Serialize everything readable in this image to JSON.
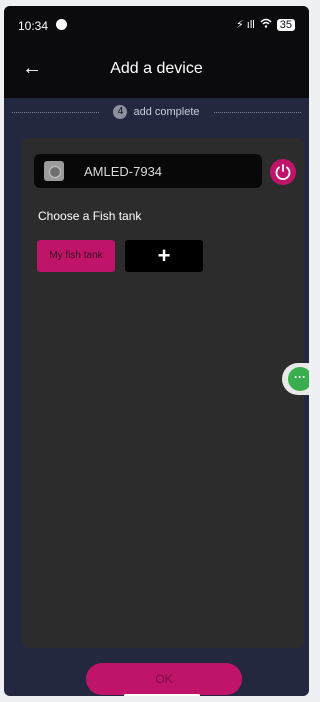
{
  "status_bar": {
    "time": "10:34",
    "indicators": "⚡ ıll",
    "wifi_icon": "wifi-icon",
    "battery": "35"
  },
  "header": {
    "back_icon": "back-arrow-icon",
    "title": "Add a device"
  },
  "step": {
    "number": "4",
    "label": "add complete"
  },
  "device": {
    "name": "AMLED-7934",
    "power_icon": "power-icon"
  },
  "fish_tank": {
    "label": "Choose a Fish tank",
    "selected_tank": "My fish tank",
    "add_icon": "plus-icon"
  },
  "floating": {
    "chat_icon": "chat-icon",
    "chat_text": "···"
  },
  "footer": {
    "ok_label": "OK"
  },
  "colors": {
    "accent": "#c0146b",
    "background": "#232840",
    "panel": "#2c2c2c"
  }
}
